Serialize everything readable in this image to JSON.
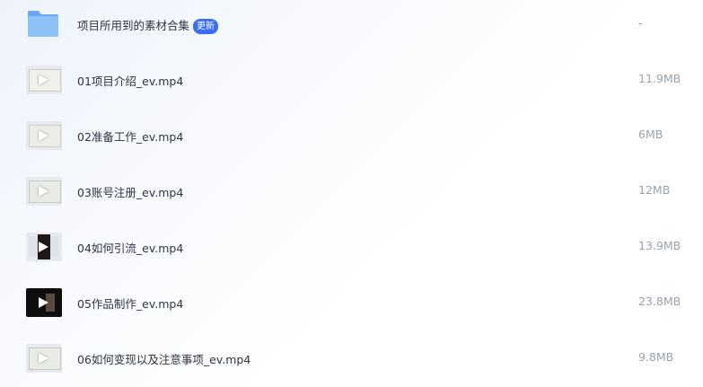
{
  "files": [
    {
      "name": "项目所用到的素材合集",
      "badge": "更新",
      "size": "-",
      "icon": "folder-icon"
    },
    {
      "name": "01项目介绍_ev.mp4",
      "size": "11.9MB",
      "icon": "video-thumbnail",
      "thumb_color": "#f0f0ea"
    },
    {
      "name": "02准备工作_ev.mp4",
      "size": "6MB",
      "icon": "video-thumbnail",
      "thumb_color": "#ecece8"
    },
    {
      "name": "03账号注册_ev.mp4",
      "size": "12MB",
      "icon": "video-thumbnail",
      "thumb_color": "#e8eae6"
    },
    {
      "name": "04如何引流_ev.mp4",
      "size": "13.9MB",
      "icon": "video-thumbnail",
      "thumb_color": "#1a1a1a"
    },
    {
      "name": "05作品制作_ev.mp4",
      "size": "23.8MB",
      "icon": "video-thumbnail",
      "thumb_color": "#0e0e0e"
    },
    {
      "name": "06如何变现以及注意事项_ev.mp4",
      "size": "9.8MB",
      "icon": "video-thumbnail",
      "thumb_color": "#e9ece6"
    }
  ],
  "colors": {
    "accent": "#3a6cf4",
    "text": "#2f3542",
    "muted": "#9aa1ad",
    "folder": "#7ab3f5"
  }
}
